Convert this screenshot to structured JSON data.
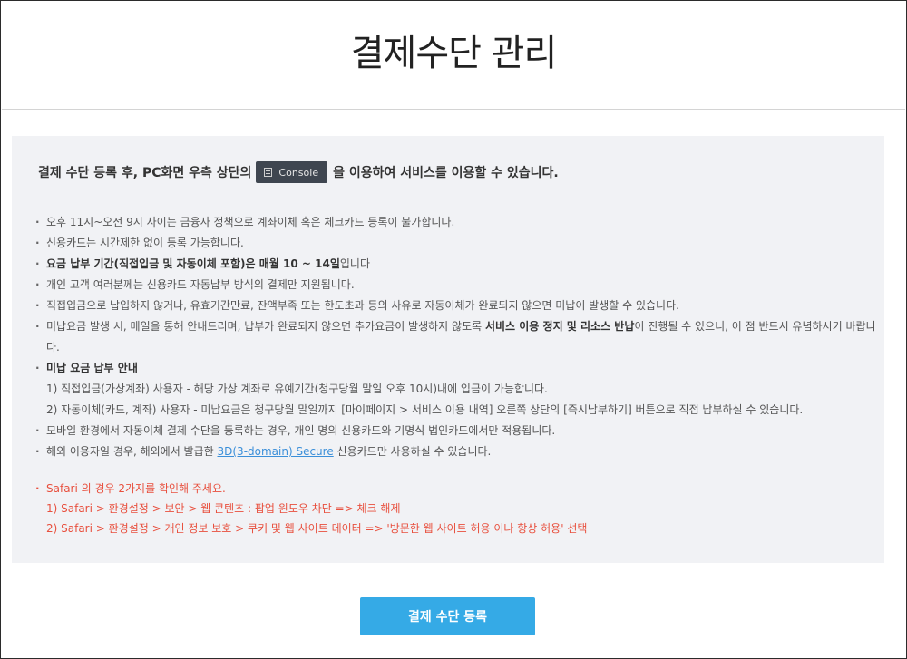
{
  "header": {
    "title": "결제수단 관리"
  },
  "lead": {
    "before": "결제 수단 등록 후, PC화면 우측 상단의",
    "badge": "Console",
    "after": "을 이용하여 서비스를 이용할 수 있습니다."
  },
  "notes": [
    {
      "text": "오후 11시~오전 9시 사이는 금융사 정책으로 계좌이체 혹은 체크카드 등록이 불가합니다."
    },
    {
      "text": "신용카드는 시간제한 없이 등록 가능합니다."
    },
    {
      "bold": "요금 납부 기간(직접입금 및 자동이체 포함)은 매월 10 ~ 14일",
      "text": "입니다"
    },
    {
      "text": "개인 고객 여러분께는 신용카드 자동납부 방식의 결제만 지원됩니다."
    },
    {
      "text": "직접입금으로 납입하지 않거나, 유효기간만료, 잔액부족 또는 한도초과 등의 사유로 자동이체가 완료되지 않으면 미납이 발생할 수 있습니다."
    },
    {
      "before": "미납요금 발생 시, 메일을 통해 안내드리며, 납부가 완료되지 않으면 추가요금이 발생하지 않도록 ",
      "bold": "서비스 이용 정지 및 리소스 반납",
      "after": "이 진행될 수 있으니, 이 점 반드시 유념하시기 바랍니다."
    },
    {
      "bold": "미납 요금 납부 안내",
      "sub1": "1) 직접입금(가상계좌) 사용자 - 해당 가상 계좌로 유예기간(청구당월 말일 오후 10시)내에 입금이 가능합니다.",
      "sub2": "2) 자동이체(카드, 계좌) 사용자 - 미납요금은 청구당월 말일까지 [마이페이지 > 서비스 이용 내역] 오른쪽 상단의 [즉시납부하기] 버튼으로 직접 납부하실 수 있습니다."
    },
    {
      "text": "모바일 환경에서 자동이체 결제 수단을 등록하는 경우, 개인 명의 신용카드와 기명식 법인카드에서만 적용됩니다."
    },
    {
      "before": "해외 이용자일 경우, 해외에서 발급한 ",
      "link": "3D(3-domain) Secure",
      "after": " 신용카드만 사용하실 수 있습니다."
    }
  ],
  "safari": {
    "head": "Safari 의 경우 2가지를 확인해 주세요.",
    "line1": "1) Safari > 환경설정 > 보안 > 웹 콘텐츠 : 팝업 윈도우 차단 => 체크 해제",
    "line2": "2) Safari > 환경설정 > 개인 정보 보호 > 쿠키 및 웹 사이트 데이터 => '방문한 웹 사이트 허용 이나 항상 허용' 선택"
  },
  "button": {
    "label": "결제 수단 등록"
  },
  "colors": {
    "accent": "#35aae6",
    "warning": "#e8503e",
    "link": "#3b8fd9",
    "badge": "#3f4650"
  },
  "icons": {
    "badge_icon": "console-icon"
  }
}
